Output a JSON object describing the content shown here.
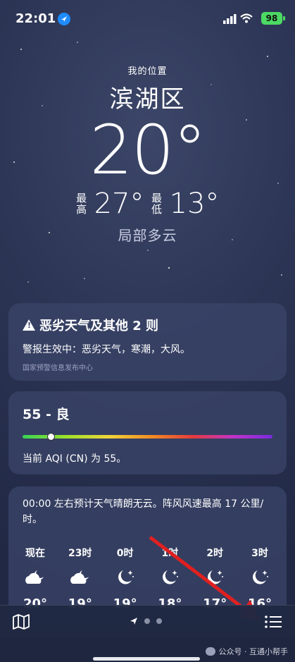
{
  "status": {
    "time": "22:01",
    "battery": "98"
  },
  "header": {
    "my_location": "我的位置",
    "city": "滨湖区",
    "temp": "20°",
    "high_label": "最高",
    "high": "27°",
    "low_label": "最低",
    "low": "13°",
    "condition": "局部多云"
  },
  "alert": {
    "title": "恶劣天气及其他 2 则",
    "body": "警报生效中：恶劣天气，寒潮，大风。",
    "source": "国家预警信息发布中心"
  },
  "aqi": {
    "title": "55 - 良",
    "level_fraction": 0.11,
    "text": "当前 AQI (CN) 为 55。"
  },
  "forecast": {
    "summary": "00:00 左右预计天气晴朗无云。阵风风速最高 17 公里/时。",
    "hours": [
      {
        "label": "现在",
        "icon": "cloud-moon-icon",
        "temp": "20°"
      },
      {
        "label": "23时",
        "icon": "cloud-moon-icon",
        "temp": "19°"
      },
      {
        "label": "0时",
        "icon": "moon-stars-icon",
        "temp": "19°"
      },
      {
        "label": "1时",
        "icon": "moon-stars-icon",
        "temp": "18°"
      },
      {
        "label": "2时",
        "icon": "moon-stars-icon",
        "temp": "17°"
      },
      {
        "label": "3时",
        "icon": "moon-stars-icon",
        "temp": "16°"
      }
    ]
  },
  "watermark": "公众号 · 互通小帮手",
  "colors": {
    "arrow": "#e02020",
    "battery": "#4cd964"
  }
}
